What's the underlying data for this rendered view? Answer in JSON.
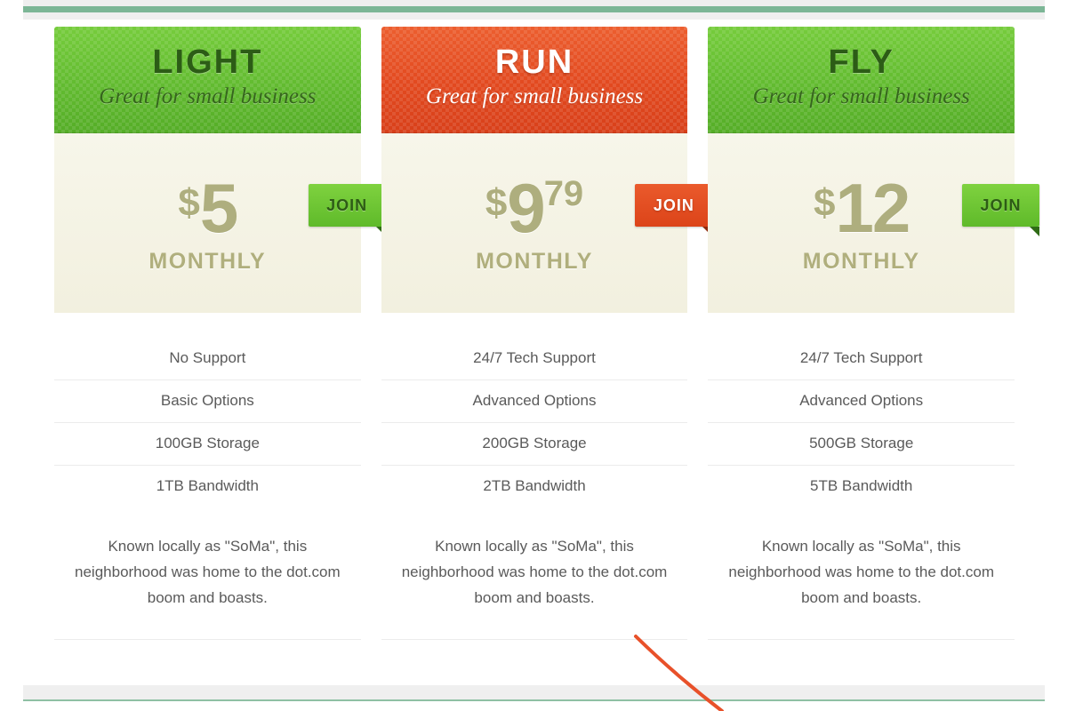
{
  "page": {
    "top_bar_color": "#7cb696",
    "bottom_bar_color": "#8fc0a4",
    "chrome_band_color": "#efefef",
    "annotation_stroke_color": "#e8512a"
  },
  "plans": [
    {
      "name": "LIGHT",
      "tagline": "Great for small business",
      "theme": "green",
      "header_bg": "#62bb30",
      "currency": "$",
      "price": "5",
      "cents": "",
      "period": "MONTHLY",
      "join_label": "JOIN",
      "features": [
        "No Support",
        "Basic Options",
        "100GB Storage",
        "1TB Bandwidth"
      ],
      "description": "Known locally as \"SoMa\", this neighborhood was home to the dot.com boom and boasts."
    },
    {
      "name": "RUN",
      "tagline": "Great for small business",
      "theme": "orange",
      "header_bg": "#e2491f",
      "currency": "$",
      "price": "9",
      "cents": "79",
      "period": "MONTHLY",
      "join_label": "JOIN",
      "features": [
        "24/7 Tech Support",
        "Advanced Options",
        "200GB Storage",
        "2TB Bandwidth"
      ],
      "description": "Known locally as \"SoMa\", this neighborhood was home to the dot.com boom and boasts."
    },
    {
      "name": "FLY",
      "tagline": "Great for small business",
      "theme": "green",
      "header_bg": "#62bb30",
      "currency": "$",
      "price": "12",
      "cents": "",
      "period": "MONTHLY",
      "join_label": "JOIN",
      "features": [
        "24/7 Tech Support",
        "Advanced Options",
        "500GB Storage",
        "5TB Bandwidth"
      ],
      "description": "Known locally as \"SoMa\", this neighborhood was home to the dot.com boom and boasts."
    }
  ]
}
